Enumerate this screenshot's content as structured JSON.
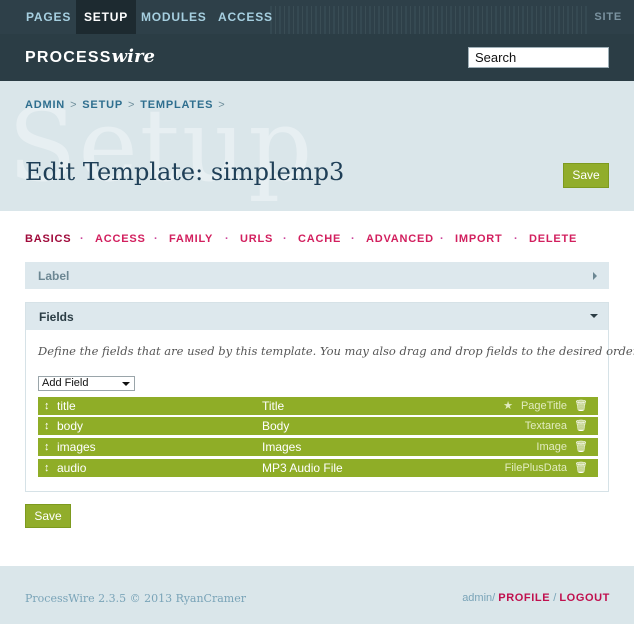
{
  "nav": {
    "items": [
      "PAGES",
      "SETUP",
      "MODULES",
      "ACCESS"
    ],
    "active": "SETUP",
    "site_label": "SITE"
  },
  "brand": {
    "process": "PROCESS",
    "wire": "wire"
  },
  "search": {
    "value": "Search"
  },
  "breadcrumb": [
    "ADMIN",
    "SETUP",
    "TEMPLATES"
  ],
  "breadcrumb_separator": ">",
  "watermark": "Setup",
  "page": {
    "title": "Edit Template: simplemp3",
    "save_label": "Save"
  },
  "tabs": [
    "BASICS",
    "ACCESS",
    "FAMILY",
    "URLS",
    "CACHE",
    "ADVANCED",
    "IMPORT",
    "DELETE"
  ],
  "tab_separator": "·",
  "active_tab": "BASICS",
  "panels": {
    "label_title": "Label",
    "fields_title": "Fields"
  },
  "fields_description": "Define the fields that are used by this template. You may also drag and drop fields to the desired order.",
  "add_field": {
    "selected": "Add Field"
  },
  "fields": [
    {
      "name": "title",
      "label": "Title",
      "type": "PageTitle",
      "starred": true
    },
    {
      "name": "body",
      "label": "Body",
      "type": "Textarea",
      "starred": false
    },
    {
      "name": "images",
      "label": "Images",
      "type": "Image",
      "starred": false
    },
    {
      "name": "audio",
      "label": "MP3 Audio File",
      "type": "FilePlusData",
      "starred": false
    }
  ],
  "bottom_save_label": "Save",
  "footer": {
    "copyright": "ProcessWire 2.3.5 © 2013 RyanCramer",
    "user": "admin",
    "slash": "/",
    "profile": "PROFILE",
    "logout": "LOGOUT"
  },
  "colors": {
    "topnav_bg": "#2e4049",
    "header_bg": "#2b3d45",
    "band_bg": "#dae6ea",
    "accent_green": "#91ad2b",
    "link_red": "#d21f5e",
    "title_blue": "#1f3f57"
  },
  "icons": {
    "move": "move-vertical-icon",
    "star": "star-icon",
    "trash": "trash-icon",
    "arrow_right": "arrow-right-icon",
    "arrow_down": "arrow-down-icon"
  }
}
